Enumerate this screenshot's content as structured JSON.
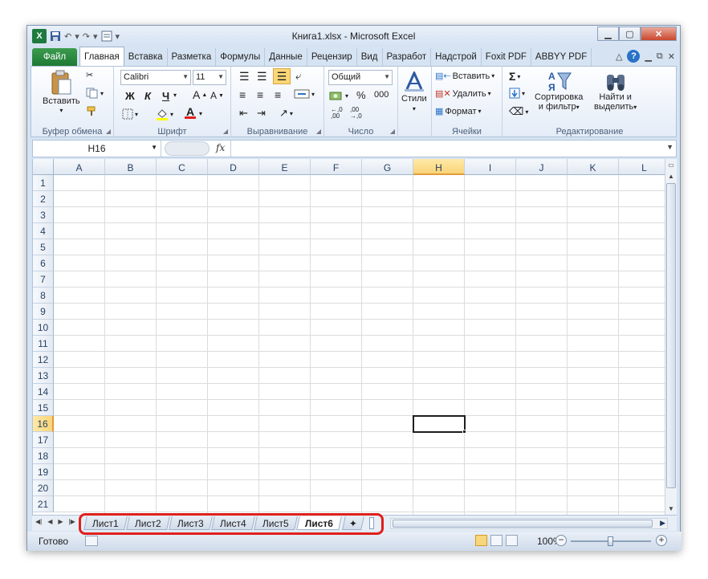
{
  "window": {
    "title": "Книга1.xlsx - Microsoft Excel"
  },
  "qat": {
    "app_icon": "excel-icon",
    "save": "save-icon",
    "undo": "↶",
    "redo": "↷",
    "form": "form-icon",
    "customize": "▾"
  },
  "tabs": [
    {
      "label": "Файл"
    },
    {
      "label": "Главная"
    },
    {
      "label": "Вставка"
    },
    {
      "label": "Разметка"
    },
    {
      "label": "Формулы"
    },
    {
      "label": "Данные"
    },
    {
      "label": "Рецензир"
    },
    {
      "label": "Вид"
    },
    {
      "label": "Разработ"
    },
    {
      "label": "Надстрой"
    },
    {
      "label": "Foxit PDF"
    },
    {
      "label": "ABBYY PDF"
    }
  ],
  "ribbon": {
    "clipboard": {
      "label": "Буфер обмена",
      "paste": "Вставить"
    },
    "font": {
      "label": "Шрифт",
      "name": "Calibri",
      "size": "11",
      "bold": "Ж",
      "italic": "К",
      "underline": "Ч"
    },
    "alignment": {
      "label": "Выравнивание"
    },
    "number": {
      "label": "Число",
      "format": "Общий",
      "percent": "%",
      "thousands": "000"
    },
    "styles": {
      "label": "Стили"
    },
    "cells": {
      "label": "Ячейки",
      "insert": "Вставить",
      "delete": "Удалить",
      "format": "Формат"
    },
    "editing": {
      "label": "Редактирование",
      "sort": "Сортировка",
      "sort2": "и фильтр",
      "find": "Найти и",
      "find2": "выделить"
    }
  },
  "formula_bar": {
    "name_box": "H16",
    "fx": "fx",
    "value": ""
  },
  "columns": [
    "A",
    "B",
    "C",
    "D",
    "E",
    "F",
    "G",
    "H",
    "I",
    "J",
    "K",
    "L"
  ],
  "rows": [
    "1",
    "2",
    "3",
    "4",
    "5",
    "6",
    "7",
    "8",
    "9",
    "10",
    "11",
    "12",
    "13",
    "14",
    "15",
    "16",
    "17",
    "18",
    "19",
    "20",
    "21"
  ],
  "selected": {
    "col": "H",
    "row": "16"
  },
  "sheets": [
    "Лист1",
    "Лист2",
    "Лист3",
    "Лист4",
    "Лист5",
    "Лист6"
  ],
  "active_sheet": "Лист6",
  "status": {
    "ready": "Готово",
    "zoom": "100%",
    "zoom_level": 100
  },
  "colors": {
    "file_tab": "#1f7a34",
    "selection": "#f9d47a",
    "highlight": "#e0201c"
  }
}
